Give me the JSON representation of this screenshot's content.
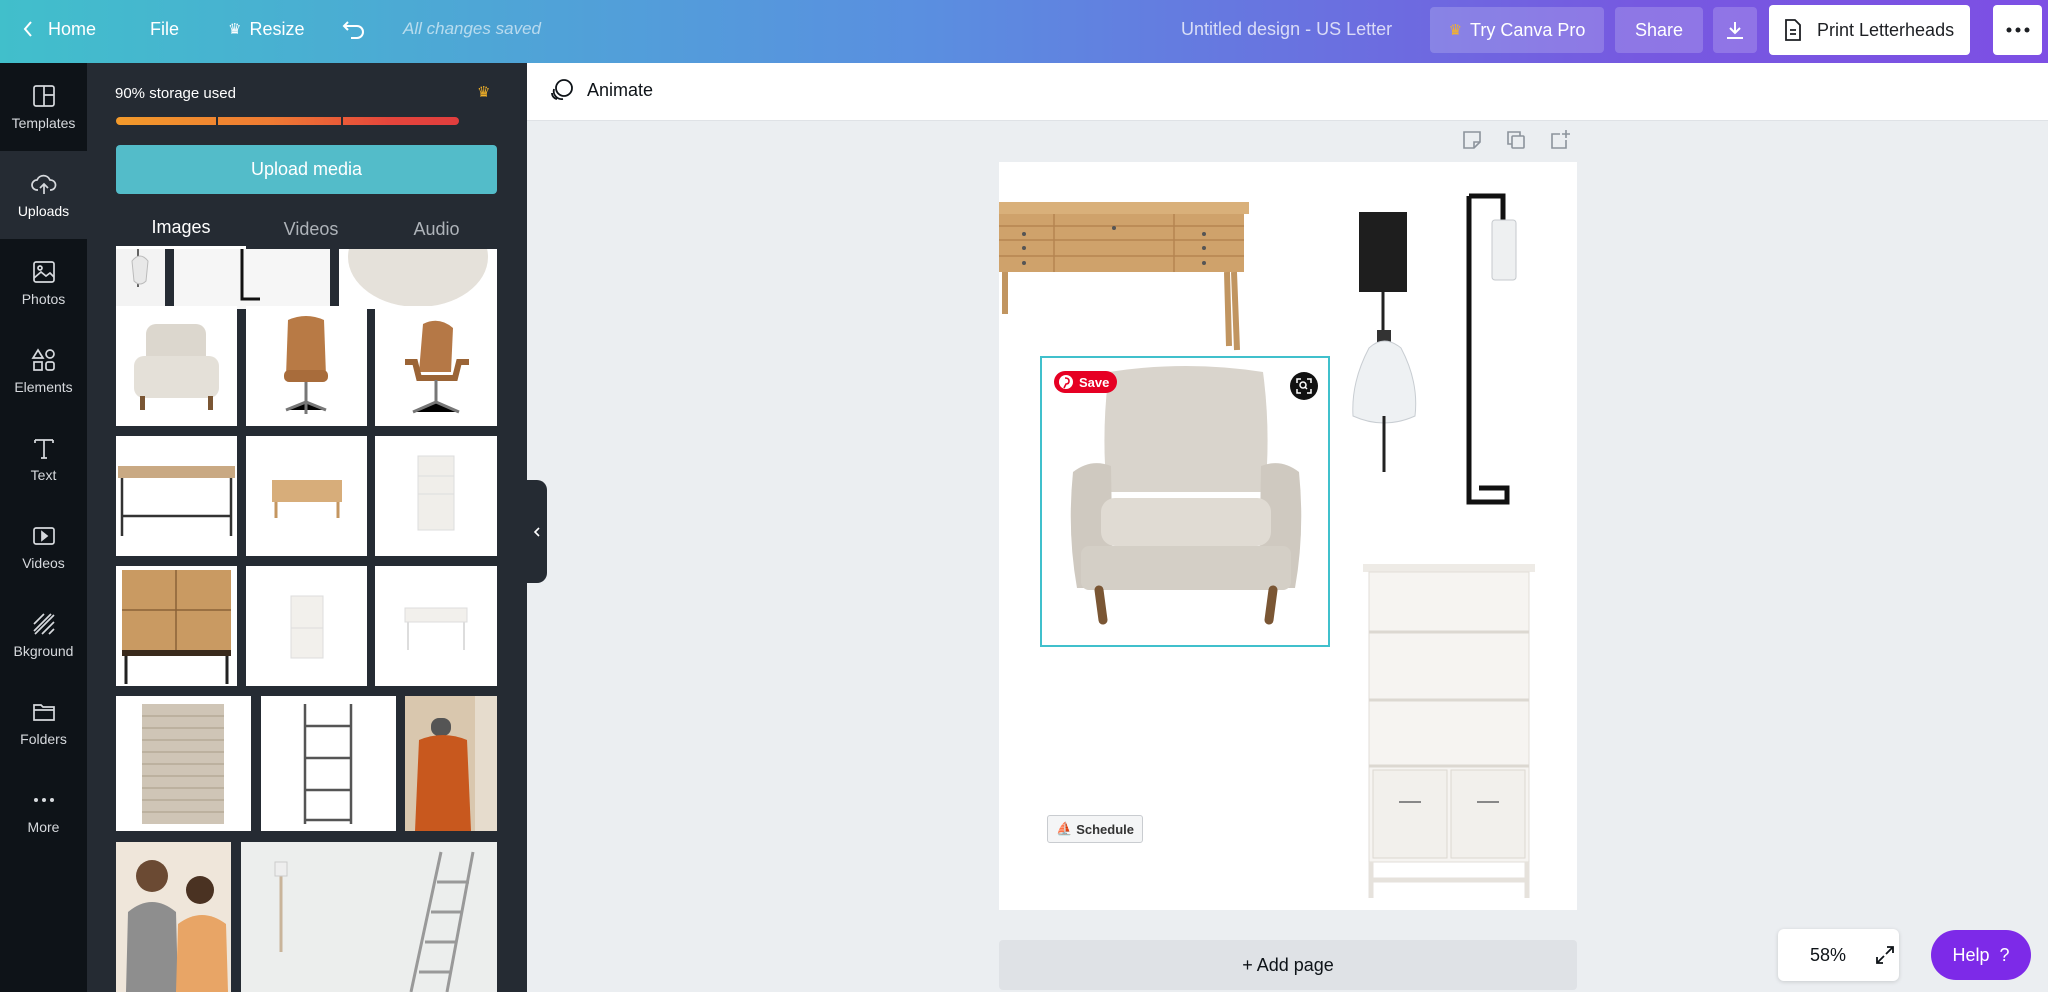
{
  "topbar": {
    "home": "Home",
    "file": "File",
    "resize": "Resize",
    "saved_status": "All changes saved",
    "doc_title": "Untitled design - US Letter",
    "try_pro": "Try Canva Pro",
    "share": "Share",
    "print": "Print Letterheads"
  },
  "leftnav": {
    "items": [
      {
        "label": "Templates",
        "icon": "templates-icon"
      },
      {
        "label": "Uploads",
        "icon": "upload-cloud-icon",
        "active": true
      },
      {
        "label": "Photos",
        "icon": "photo-icon"
      },
      {
        "label": "Elements",
        "icon": "shapes-icon"
      },
      {
        "label": "Text",
        "icon": "text-icon"
      },
      {
        "label": "Videos",
        "icon": "video-icon"
      },
      {
        "label": "Bkground",
        "icon": "background-icon"
      },
      {
        "label": "Folders",
        "icon": "folder-icon"
      },
      {
        "label": "More",
        "icon": "more-dots-icon"
      }
    ]
  },
  "panel": {
    "storage_text": "90% storage used",
    "storage_used_fraction": 0.9,
    "upload_button": "Upload media",
    "tabs": [
      "Images",
      "Videos",
      "Audio"
    ],
    "active_tab": "Images"
  },
  "editor": {
    "animate": "Animate",
    "save_badge": "Save",
    "schedule": "Schedule",
    "add_page": "+ Add page",
    "zoom": "58%",
    "help": "Help"
  },
  "colors": {
    "accent_teal": "#40c0cc",
    "pro_purple": "#7d2ae8",
    "pinterest_red": "#e60023"
  }
}
